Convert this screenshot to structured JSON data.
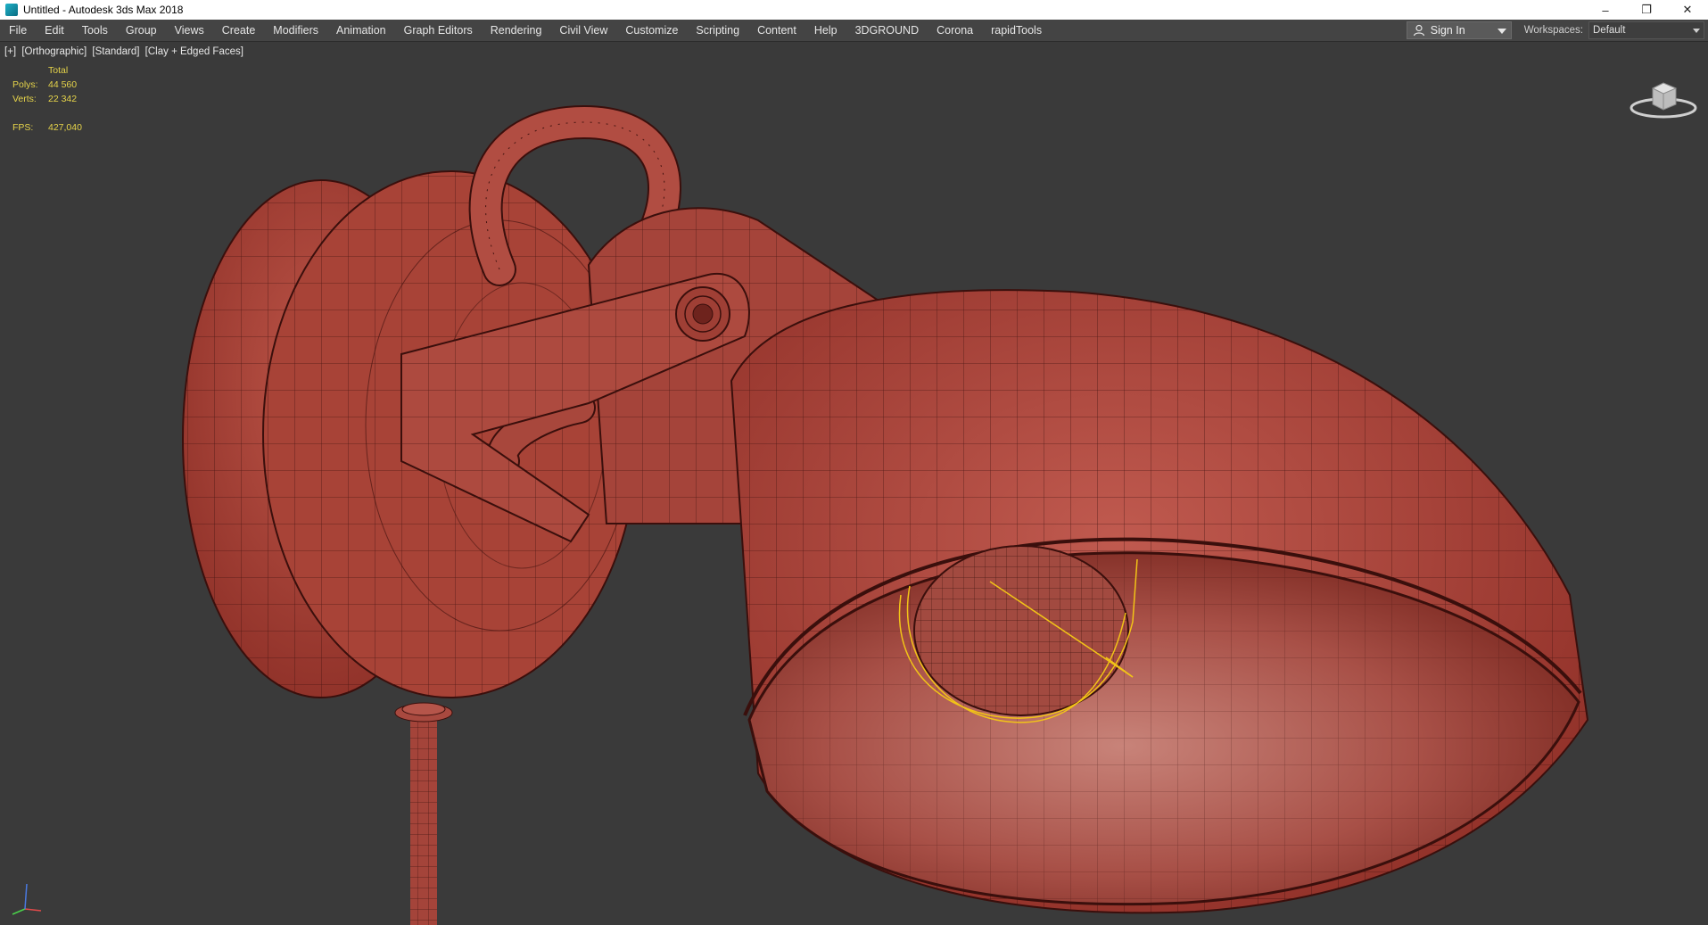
{
  "window": {
    "title": "Untitled - Autodesk 3ds Max 2018",
    "controls": [
      "–",
      "❐",
      "✕"
    ]
  },
  "menu": {
    "items": [
      "File",
      "Edit",
      "Tools",
      "Group",
      "Views",
      "Create",
      "Modifiers",
      "Animation",
      "Graph Editors",
      "Rendering",
      "Civil View",
      "Customize",
      "Scripting",
      "Content",
      "Help",
      "3DGROUND",
      "Corona",
      "rapidTools"
    ],
    "sign_in": "Sign In",
    "workspaces_label": "Workspaces:",
    "workspace_value": "Default"
  },
  "viewport": {
    "label_parts": [
      "[+]",
      "[Orthographic]",
      "[Standard]",
      "[Clay + Edged Faces]"
    ],
    "stats": {
      "header": "Total",
      "polys_label": "Polys:",
      "polys_value": "44 560",
      "verts_label": "Verts:",
      "verts_value": "22 342",
      "fps_label": "FPS:",
      "fps_value": "427,040"
    }
  },
  "colors": {
    "background": "#3a3a3a",
    "model_clay": "#b0463c",
    "wire": "#3a0f0c",
    "selection": "#f2c417",
    "stats_text": "#e6d44a"
  }
}
